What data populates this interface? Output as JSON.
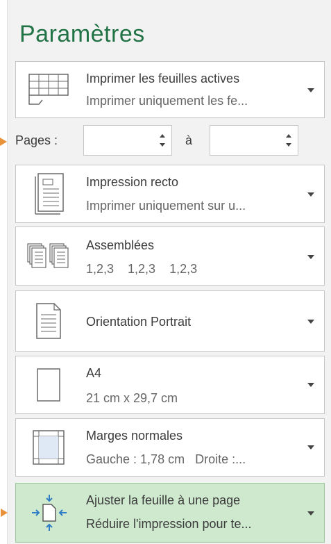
{
  "section_title": "Paramètres",
  "print_what": {
    "line1": "Imprimer les feuilles actives",
    "line2": "Imprimer uniquement les fe..."
  },
  "pages": {
    "label": "Pages :",
    "from_value": "",
    "to_label": "à",
    "to_value": ""
  },
  "sides": {
    "line1": "Impression recto",
    "line2": "Imprimer uniquement sur u..."
  },
  "collation": {
    "line1": "Assemblées",
    "line2": "1,2,3    1,2,3    1,2,3"
  },
  "orientation": {
    "line1": "Orientation Portrait"
  },
  "paper_size": {
    "line1": "A4",
    "line2": "21 cm x 29,7 cm"
  },
  "margins": {
    "line1": "Marges normales",
    "line2": "Gauche : 1,78 cm   Droite :..."
  },
  "scaling": {
    "line1": "Ajuster la feuille à une page",
    "line2": "Réduire l'impression pour te...",
    "selected": true
  },
  "colors": {
    "title_green": "#217346",
    "selected_bg": "#cfe9cf",
    "accent_orange": "#e8923a"
  }
}
